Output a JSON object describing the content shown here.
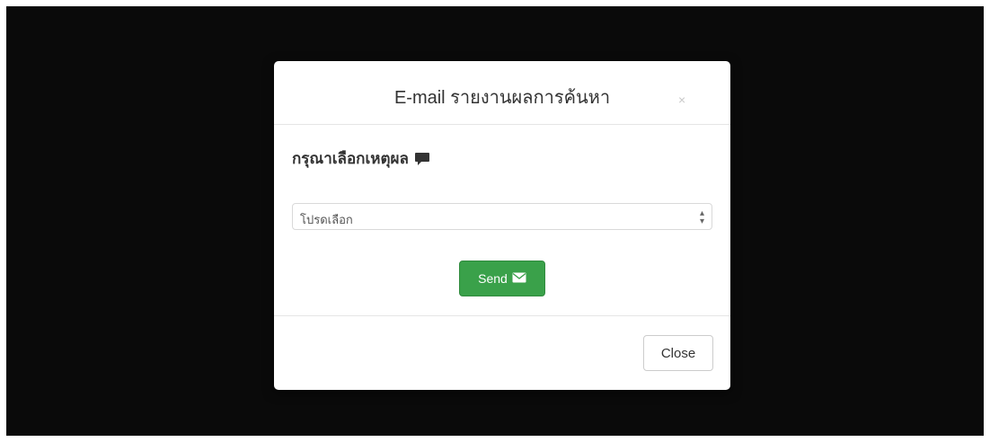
{
  "modal": {
    "title": "E-mail รายงานผลการค้นหา",
    "close_x": "×",
    "reason_label": "กรุณาเลือกเหตุผล",
    "reason_icon": "comment-icon",
    "select": {
      "selected": "โปรดเลือก"
    },
    "send_label": "Send",
    "send_icon": "envelope-icon",
    "close_label": "Close"
  },
  "colors": {
    "backdrop": "#0a0a0a",
    "send_button": "#3aa14a",
    "modal_bg": "#ffffff"
  }
}
